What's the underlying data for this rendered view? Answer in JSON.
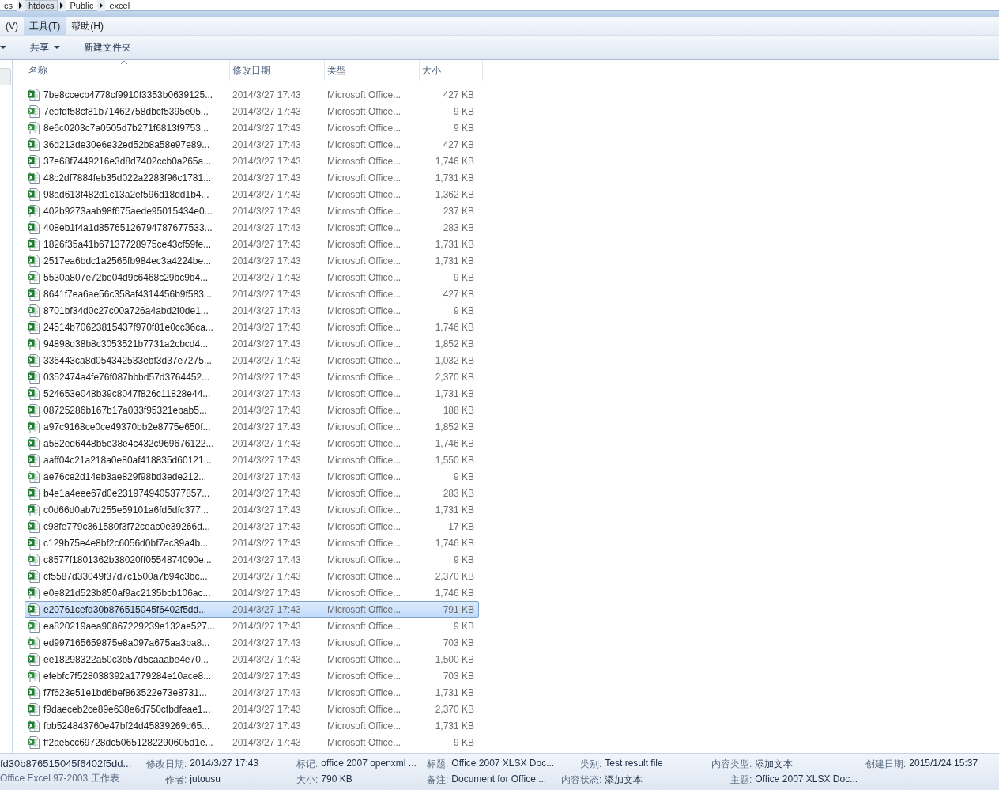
{
  "breadcrumb": [
    {
      "label": "cs"
    },
    {
      "label": "htdocs",
      "selected": true
    },
    {
      "label": "Public",
      "selected": false
    },
    {
      "label": "excel",
      "selected": false
    }
  ],
  "menu": [
    {
      "label": "(V)",
      "selected": false
    },
    {
      "label": "工具(T)",
      "selected": true
    },
    {
      "label": "帮助(H)",
      "selected": false
    }
  ],
  "toolbar": [
    {
      "label": "共享",
      "dropdown": true
    },
    {
      "label": "新建文件夹",
      "dropdown": false
    }
  ],
  "table": {
    "columns": [
      "名称",
      "修改日期",
      "类型",
      "大小"
    ],
    "rows": [
      {
        "name": "7be8ccecb4778cf9910f3353b0639125...",
        "date": "2014/3/27 17:43",
        "type": "Microsoft Office...",
        "size": "427 KB",
        "kind": "xlsx",
        "selected": false
      },
      {
        "name": "7edfdf58cf81b71462758dbcf5395e05...",
        "date": "2014/3/27 17:43",
        "type": "Microsoft Office...",
        "size": "9 KB",
        "kind": "xls",
        "selected": false
      },
      {
        "name": "8e6c0203c7a0505d7b271f6813f9753...",
        "date": "2014/3/27 17:43",
        "type": "Microsoft Office...",
        "size": "9 KB",
        "kind": "xls",
        "selected": false
      },
      {
        "name": "36d213de30e6e32ed52b8a58e97e89...",
        "date": "2014/3/27 17:43",
        "type": "Microsoft Office...",
        "size": "427 KB",
        "kind": "xlsx",
        "selected": false
      },
      {
        "name": "37e68f7449216e3d8d7402ccb0a265a...",
        "date": "2014/3/27 17:43",
        "type": "Microsoft Office...",
        "size": "1,746 KB",
        "kind": "xlsx",
        "selected": false
      },
      {
        "name": "48c2df7884feb35d022a2283f96c1781...",
        "date": "2014/3/27 17:43",
        "type": "Microsoft Office...",
        "size": "1,731 KB",
        "kind": "xlsx",
        "selected": false
      },
      {
        "name": "98ad613f482d1c13a2ef596d18dd1b4...",
        "date": "2014/3/27 17:43",
        "type": "Microsoft Office...",
        "size": "1,362 KB",
        "kind": "xlsx",
        "selected": false
      },
      {
        "name": "402b9273aab98f675aede95015434e0...",
        "date": "2014/3/27 17:43",
        "type": "Microsoft Office...",
        "size": "237 KB",
        "kind": "xlsx",
        "selected": false
      },
      {
        "name": "408eb1f4a1d85765126794787677533...",
        "date": "2014/3/27 17:43",
        "type": "Microsoft Office...",
        "size": "283 KB",
        "kind": "xlsx",
        "selected": false
      },
      {
        "name": "1826f35a41b67137728975ce43cf59fe...",
        "date": "2014/3/27 17:43",
        "type": "Microsoft Office...",
        "size": "1,731 KB",
        "kind": "xlsx",
        "selected": false
      },
      {
        "name": "2517ea6bdc1a2565fb984ec3a4224be...",
        "date": "2014/3/27 17:43",
        "type": "Microsoft Office...",
        "size": "1,731 KB",
        "kind": "xlsx",
        "selected": false
      },
      {
        "name": "5530a807e72be04d9c6468c29bc9b4...",
        "date": "2014/3/27 17:43",
        "type": "Microsoft Office...",
        "size": "9 KB",
        "kind": "xls",
        "selected": false
      },
      {
        "name": "8641f7ea6ae56c358af4314456b9f583...",
        "date": "2014/3/27 17:43",
        "type": "Microsoft Office...",
        "size": "427 KB",
        "kind": "xlsx",
        "selected": false
      },
      {
        "name": "8701bf34d0c27c00a726a4abd2f0de1...",
        "date": "2014/3/27 17:43",
        "type": "Microsoft Office...",
        "size": "9 KB",
        "kind": "xls",
        "selected": false
      },
      {
        "name": "24514b70623815437f970f81e0cc36ca...",
        "date": "2014/3/27 17:43",
        "type": "Microsoft Office...",
        "size": "1,746 KB",
        "kind": "xlsx",
        "selected": false
      },
      {
        "name": "94898d38b8c3053521b7731a2cbcd4...",
        "date": "2014/3/27 17:43",
        "type": "Microsoft Office...",
        "size": "1,852 KB",
        "kind": "xlsx",
        "selected": false
      },
      {
        "name": "336443ca8d054342533ebf3d37e7275...",
        "date": "2014/3/27 17:43",
        "type": "Microsoft Office...",
        "size": "1,032 KB",
        "kind": "xlsx",
        "selected": false
      },
      {
        "name": "0352474a4fe76f087bbbd57d3764452...",
        "date": "2014/3/27 17:43",
        "type": "Microsoft Office...",
        "size": "2,370 KB",
        "kind": "xlsx",
        "selected": false
      },
      {
        "name": "524653e048b39c8047f826c11828e44...",
        "date": "2014/3/27 17:43",
        "type": "Microsoft Office...",
        "size": "1,731 KB",
        "kind": "xlsx",
        "selected": false
      },
      {
        "name": "08725286b167b17a033f95321ebab5...",
        "date": "2014/3/27 17:43",
        "type": "Microsoft Office...",
        "size": "188 KB",
        "kind": "xlsx",
        "selected": false
      },
      {
        "name": "a97c9168ce0ce49370bb2e8775e650f...",
        "date": "2014/3/27 17:43",
        "type": "Microsoft Office...",
        "size": "1,852 KB",
        "kind": "xlsx",
        "selected": false
      },
      {
        "name": "a582ed6448b5e38e4c432c969676122...",
        "date": "2014/3/27 17:43",
        "type": "Microsoft Office...",
        "size": "1,746 KB",
        "kind": "xlsx",
        "selected": false
      },
      {
        "name": "aaff04c21a218a0e80af418835d60121...",
        "date": "2014/3/27 17:43",
        "type": "Microsoft Office...",
        "size": "1,550 KB",
        "kind": "xlsx",
        "selected": false
      },
      {
        "name": "ae76ce2d14eb3ae829f98bd3ede212...",
        "date": "2014/3/27 17:43",
        "type": "Microsoft Office...",
        "size": "9 KB",
        "kind": "xls",
        "selected": false
      },
      {
        "name": "b4e1a4eee67d0e2319749405377857...",
        "date": "2014/3/27 17:43",
        "type": "Microsoft Office...",
        "size": "283 KB",
        "kind": "xlsx",
        "selected": false
      },
      {
        "name": "c0d66d0ab7d255e59101a6fd5dfc377...",
        "date": "2014/3/27 17:43",
        "type": "Microsoft Office...",
        "size": "1,731 KB",
        "kind": "xlsx",
        "selected": false
      },
      {
        "name": "c98fe779c361580f3f72ceac0e39266d...",
        "date": "2014/3/27 17:43",
        "type": "Microsoft Office...",
        "size": "17 KB",
        "kind": "xlsx",
        "selected": false
      },
      {
        "name": "c129b75e4e8bf2c6056d0bf7ac39a4b...",
        "date": "2014/3/27 17:43",
        "type": "Microsoft Office...",
        "size": "1,746 KB",
        "kind": "xlsx",
        "selected": false
      },
      {
        "name": "c8577f1801362b38020ff0554874090e...",
        "date": "2014/3/27 17:43",
        "type": "Microsoft Office...",
        "size": "9 KB",
        "kind": "xls",
        "selected": false
      },
      {
        "name": "cf5587d33049f37d7c1500a7b94c3bc...",
        "date": "2014/3/27 17:43",
        "type": "Microsoft Office...",
        "size": "2,370 KB",
        "kind": "xlsx",
        "selected": false
      },
      {
        "name": "e0e821d523b850af9ac2135bcb106ac...",
        "date": "2014/3/27 17:43",
        "type": "Microsoft Office...",
        "size": "1,746 KB",
        "kind": "xlsx",
        "selected": false
      },
      {
        "name": "e20761cefd30b876515045f6402f5dd...",
        "date": "2014/3/27 17:43",
        "type": "Microsoft Office...",
        "size": "791 KB",
        "kind": "xlsx",
        "selected": true
      },
      {
        "name": "ea820219aea90867229239e132ae527...",
        "date": "2014/3/27 17:43",
        "type": "Microsoft Office...",
        "size": "9 KB",
        "kind": "xls",
        "selected": false
      },
      {
        "name": "ed997165659875e8a097a675aa3ba8...",
        "date": "2014/3/27 17:43",
        "type": "Microsoft Office...",
        "size": "703 KB",
        "kind": "xls",
        "selected": false
      },
      {
        "name": "ee18298322a50c3b57d5caaabe4e70...",
        "date": "2014/3/27 17:43",
        "type": "Microsoft Office...",
        "size": "1,500 KB",
        "kind": "xlsx",
        "selected": false
      },
      {
        "name": "efebfc7f528038392a1779284e10ace8...",
        "date": "2014/3/27 17:43",
        "type": "Microsoft Office...",
        "size": "703 KB",
        "kind": "xls",
        "selected": false
      },
      {
        "name": "f7f623e51e1bd6bef863522e73e8731...",
        "date": "2014/3/27 17:43",
        "type": "Microsoft Office...",
        "size": "1,731 KB",
        "kind": "xlsx",
        "selected": false
      },
      {
        "name": "f9daeceb2ce89e638e6d750cfbdfeae1...",
        "date": "2014/3/27 17:43",
        "type": "Microsoft Office...",
        "size": "2,370 KB",
        "kind": "xlsx",
        "selected": false
      },
      {
        "name": "fbb524843760e47bf24d45839269d65...",
        "date": "2014/3/27 17:43",
        "type": "Microsoft Office...",
        "size": "1,731 KB",
        "kind": "xlsx",
        "selected": false
      },
      {
        "name": "ff2ae5cc69728dc50651282290605d1e...",
        "date": "2014/3/27 17:43",
        "type": "Microsoft Office...",
        "size": "9 KB",
        "kind": "xls",
        "selected": false
      }
    ]
  },
  "status_bar": {
    "file_name": "fd30b876515045f6402f5dd...",
    "file_type": "Office Excel 97-2003 工作表",
    "columns": [
      [
        {
          "label": "修改日期:",
          "value": "2014/3/27 17:43"
        },
        {
          "label": "作者:",
          "value": "jutousu"
        }
      ],
      [
        {
          "label": "标记:",
          "value": "office 2007 openxml ..."
        },
        {
          "label": "大小:",
          "value": "790 KB"
        }
      ],
      [
        {
          "label": "标题:",
          "value": "Office 2007 XLSX Doc..."
        },
        {
          "label": "备注:",
          "value": "Document for Office ..."
        }
      ],
      [
        {
          "label": "类别:",
          "value": "Test result file"
        },
        {
          "label": "内容状态:",
          "value": "添加文本"
        }
      ],
      [
        {
          "label": "内容类型:",
          "value": "添加文本"
        },
        {
          "label": "主题:",
          "value": "Office 2007 XLSX Doc..."
        }
      ],
      [
        {
          "label": "创建日期:",
          "value": "2015/1/24 15:37"
        }
      ]
    ]
  }
}
